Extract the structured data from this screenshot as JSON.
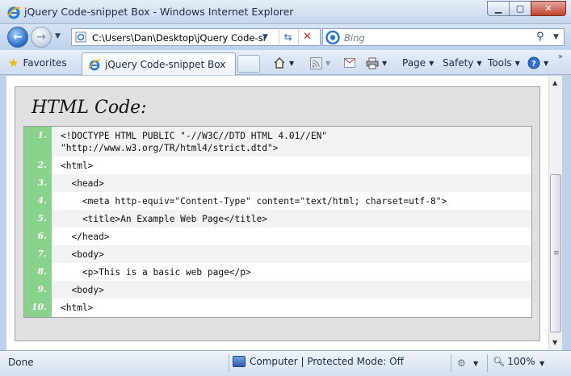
{
  "window": {
    "title": "jQuery Code-snippet Box - Windows Internet Explorer"
  },
  "addressbar": {
    "url": "C:\\Users\\Dan\\Desktop\\jQuery Code-sni",
    "search_placeholder": "Bing"
  },
  "commandbar": {
    "favorites_label": "Favorites",
    "tab_label": "jQuery Code-snippet Box",
    "page_label": "Page",
    "safety_label": "Safety",
    "tools_label": "Tools"
  },
  "content": {
    "heading": "HTML Code:",
    "code_lines": [
      {
        "num": "1.",
        "text": "<!DOCTYPE HTML PUBLIC \"-//W3C//DTD HTML 4.01//EN\"\n\"http://www.w3.org/TR/html4/strict.dtd\">"
      },
      {
        "num": "2.",
        "text": "<html>"
      },
      {
        "num": "3.",
        "text": "  <head>"
      },
      {
        "num": "4.",
        "text": "    <meta http-equiv=\"Content-Type\" content=\"text/html; charset=utf-8\">"
      },
      {
        "num": "5.",
        "text": "    <title>An Example Web Page</title>"
      },
      {
        "num": "6.",
        "text": "  </head>"
      },
      {
        "num": "7.",
        "text": "  <body>"
      },
      {
        "num": "8.",
        "text": "    <p>This is a basic web page</p>"
      },
      {
        "num": "9.",
        "text": "  <body>"
      },
      {
        "num": "10.",
        "text": "<html>"
      }
    ]
  },
  "statusbar": {
    "status_text": "Done",
    "zone_text": "Computer | Protected Mode: Off",
    "zoom_text": "100%"
  },
  "colors": {
    "gutter": "#89d28b",
    "chrome": "#bcd3ea"
  }
}
